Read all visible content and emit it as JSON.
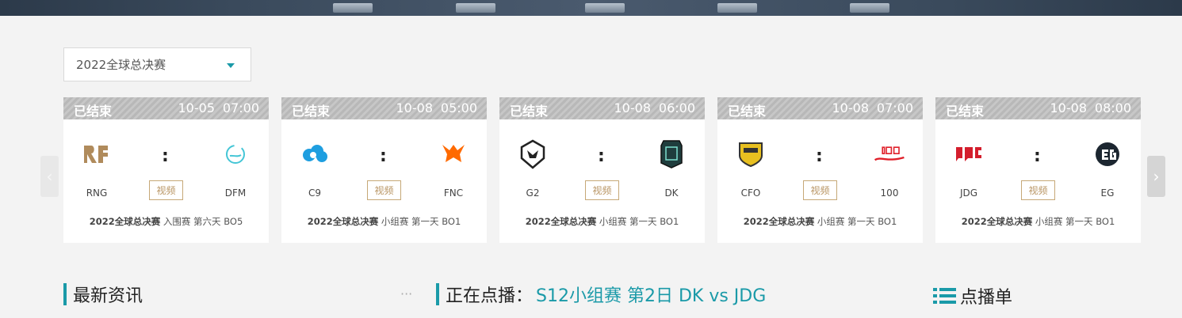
{
  "season_select": {
    "value": "2022全球总决赛"
  },
  "arrows": {
    "left": "‹",
    "right": "›"
  },
  "matches": [
    {
      "status": "已结束",
      "date": "10-05",
      "time": "07:00",
      "team_a": "RNG",
      "team_b": "DFM",
      "colon": ":",
      "video": "视频",
      "event": "2022全球总决赛",
      "stage": "入围赛 第六天 BO5"
    },
    {
      "status": "已结束",
      "date": "10-08",
      "time": "05:00",
      "team_a": "C9",
      "team_b": "FNC",
      "colon": ":",
      "video": "视频",
      "event": "2022全球总决赛",
      "stage": "小组赛 第一天 BO1"
    },
    {
      "status": "已结束",
      "date": "10-08",
      "time": "06:00",
      "team_a": "G2",
      "team_b": "DK",
      "colon": ":",
      "video": "视频",
      "event": "2022全球总决赛",
      "stage": "小组赛 第一天 BO1"
    },
    {
      "status": "已结束",
      "date": "10-08",
      "time": "07:00",
      "team_a": "CFO",
      "team_b": "100",
      "colon": ":",
      "video": "视频",
      "event": "2022全球总决赛",
      "stage": "小组赛 第一天 BO1"
    },
    {
      "status": "已结束",
      "date": "10-08",
      "time": "08:00",
      "team_a": "JDG",
      "team_b": "EG",
      "colon": ":",
      "video": "视频",
      "event": "2022全球总决赛",
      "stage": "小组赛 第一天 BO1"
    }
  ],
  "news": {
    "title": "最新资讯",
    "more": "···"
  },
  "now_playing": {
    "label": "正在点播：",
    "title": "S12小组赛 第2日 DK vs JDG"
  },
  "playlist": {
    "title": "点播单",
    "icon": "list-icon"
  },
  "colors": {
    "accent": "#1a9aa8",
    "video_border": "#c6a877"
  }
}
